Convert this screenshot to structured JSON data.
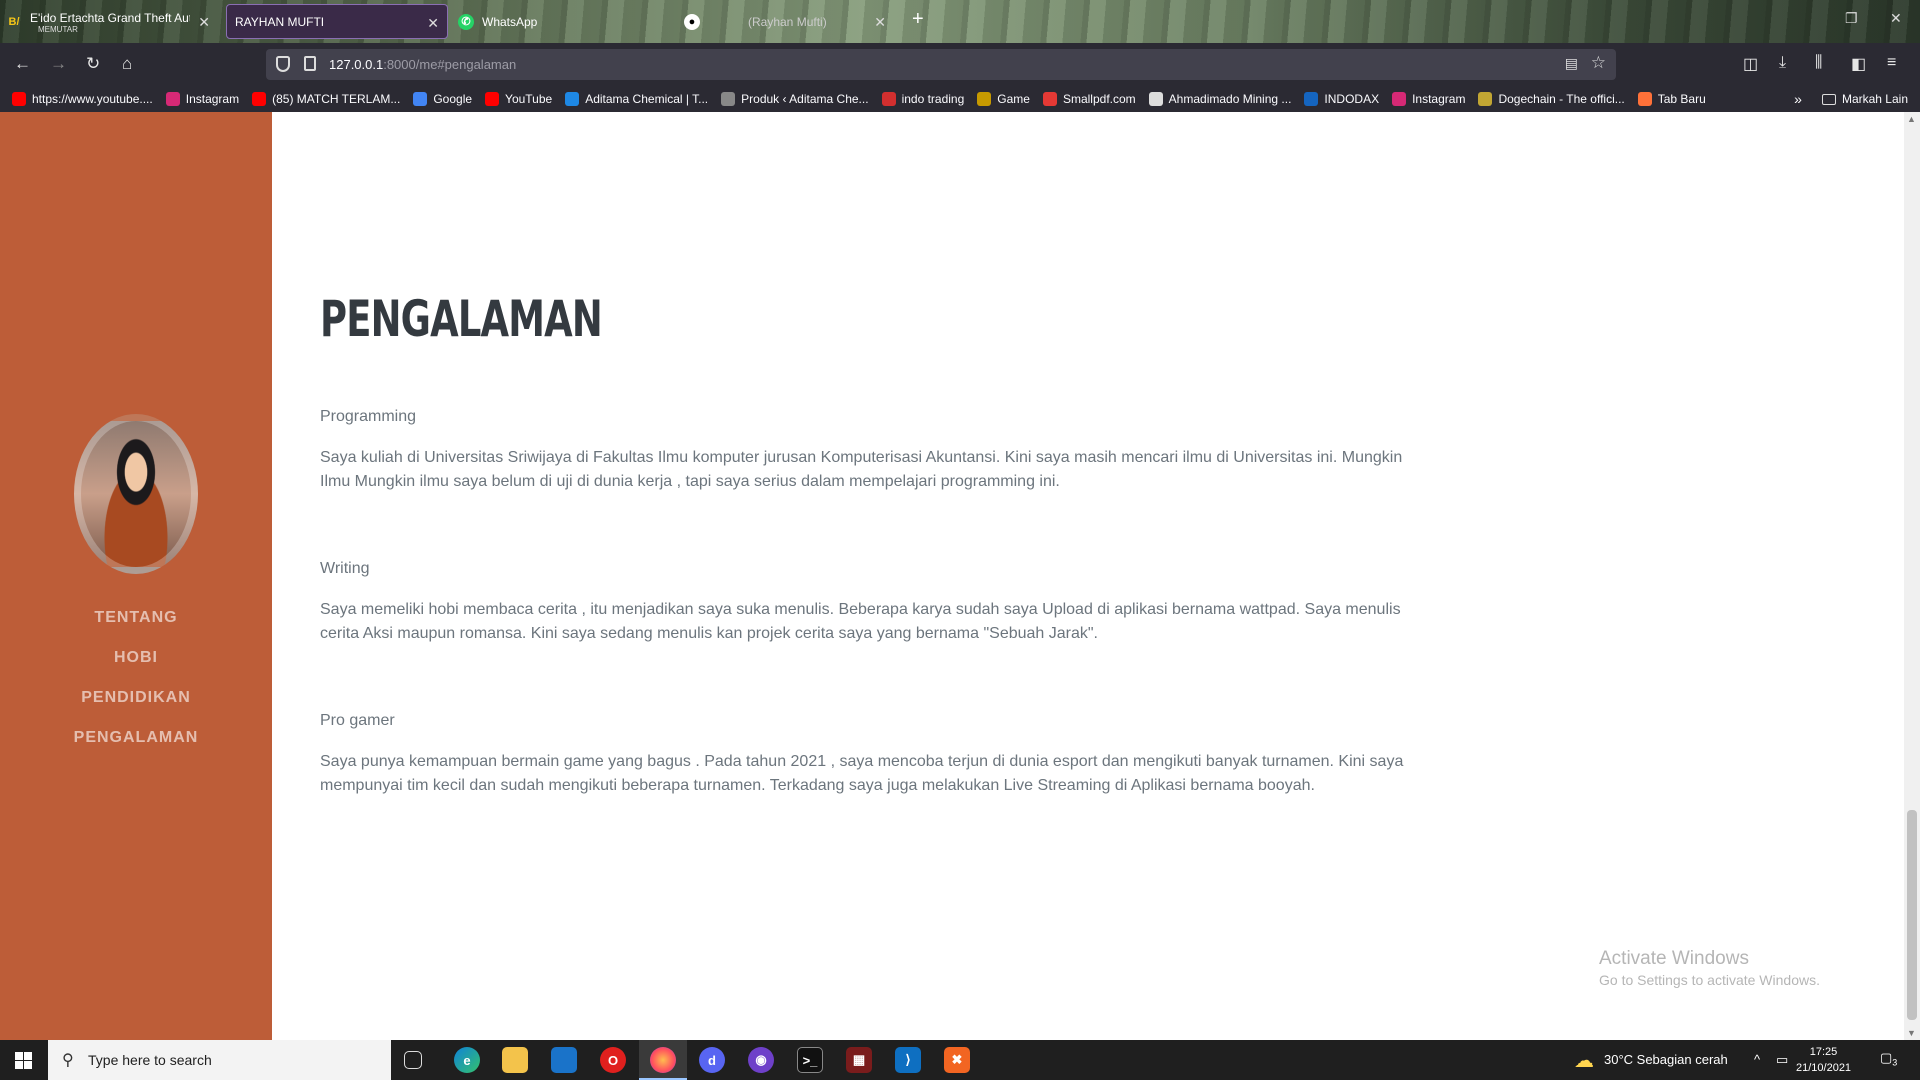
{
  "browser": {
    "tabs": [
      {
        "title": "E'ido Ertachta Grand Theft Auto",
        "subtitle": "MEMUTAR",
        "icon": "bv-icon"
      },
      {
        "title": "RAYHAN MUFTI",
        "icon": ""
      },
      {
        "title": "WhatsApp",
        "icon": "whatsapp-icon"
      },
      {
        "title": "(Rayhan Mufti)",
        "icon": "github-icon"
      }
    ],
    "url_host": "127.0.0.1",
    "url_path": ":8000/me#pengalaman",
    "bookmarks": [
      {
        "label": "https://www.youtube....",
        "color": "#ff0000"
      },
      {
        "label": "Instagram",
        "color": "#d62976"
      },
      {
        "label": "(85) MATCH TERLAM...",
        "color": "#ff0000"
      },
      {
        "label": "Google",
        "color": "#4285f4"
      },
      {
        "label": "YouTube",
        "color": "#ff0000"
      },
      {
        "label": "Aditama Chemical | T...",
        "color": "#1e88e5"
      },
      {
        "label": "Produk ‹ Aditama Che...",
        "color": "#888888"
      },
      {
        "label": "indo trading",
        "color": "#d32f2f"
      },
      {
        "label": "Game",
        "color": "#c79a00"
      },
      {
        "label": "Smallpdf.com",
        "color": "#e53935"
      },
      {
        "label": "Ahmadimado Mining ...",
        "color": "#dddddd"
      },
      {
        "label": "INDODAX",
        "color": "#1565c0"
      },
      {
        "label": "Instagram",
        "color": "#d62976"
      },
      {
        "label": "Dogechain - The offici...",
        "color": "#c2a633"
      },
      {
        "label": "Tab Baru",
        "color": "#ff7139"
      }
    ],
    "other_bookmarks": "Markah Lain"
  },
  "sidebar": {
    "nav": [
      {
        "label": "TENTANG"
      },
      {
        "label": "HOBI"
      },
      {
        "label": "PENDIDIKAN"
      },
      {
        "label": "PENGALAMAN"
      }
    ]
  },
  "section": {
    "title": "PENGALAMAN",
    "items": [
      {
        "title": "Programming",
        "text": "Saya kuliah di Universitas Sriwijaya di Fakultas Ilmu komputer jurusan Komputerisasi Akuntansi. Kini saya masih mencari ilmu di Universitas ini. Mungkin Ilmu Mungkin ilmu saya belum di uji di dunia kerja , tapi saya serius dalam mempelajari programming ini."
      },
      {
        "title": "Writing",
        "text": "Saya memeliki hobi membaca cerita , itu menjadikan saya suka menulis. Beberapa karya sudah saya Upload di aplikasi bernama wattpad. Saya menulis cerita Aksi maupun romansa. Kini saya sedang menulis kan projek cerita saya yang bernama \"Sebuah Jarak\"."
      },
      {
        "title": "Pro gamer",
        "text": "Saya punya kemampuan bermain game yang bagus . Pada tahun 2021 , saya mencoba terjun di dunia esport dan mengikuti banyak turnamen. Kini saya mempunyai tim kecil dan sudah mengikuti beberapa turnamen. Terkadang saya juga melakukan Live Streaming di Aplikasi bernama booyah."
      }
    ]
  },
  "watermark": {
    "line1": "Activate Windows",
    "line2": "Go to Settings to activate Windows."
  },
  "taskbar": {
    "search_placeholder": "Type here to search",
    "weather": "30°C  Sebagian cerah",
    "time": "17:25",
    "date": "21/10/2021",
    "notification_count": "3"
  }
}
